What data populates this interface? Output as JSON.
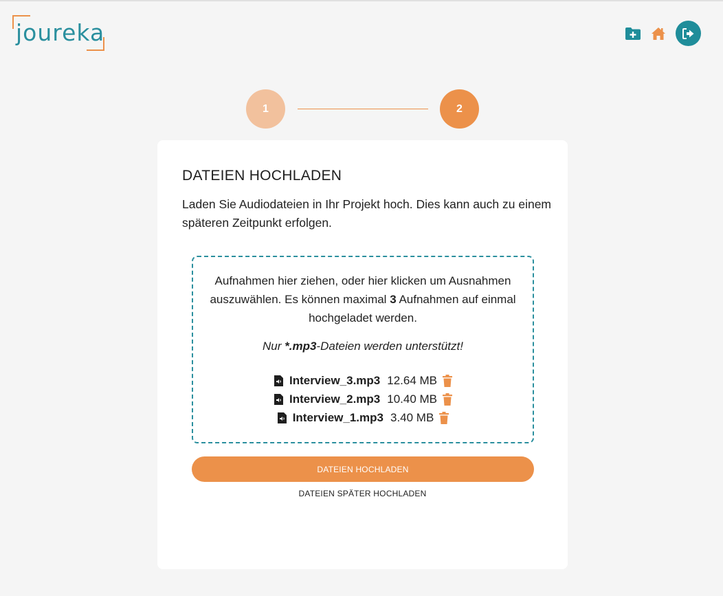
{
  "brand": {
    "logo_text": "joureka",
    "accent": "#ec914a",
    "primary": "#2a8f9e"
  },
  "header": {
    "icons": [
      "folder-plus-icon",
      "home-icon",
      "logout-icon"
    ]
  },
  "stepper": {
    "steps": [
      "1",
      "2"
    ],
    "active": 2
  },
  "card": {
    "title": "DATEIEN HOCHLADEN",
    "description": "Laden Sie Audiodateien in Ihr Projekt hoch. Dies kann auch zu einem späteren Zeitpunkt erfolgen."
  },
  "dropzone": {
    "text_before": "Aufnahmen hier ziehen, oder hier klicken um Ausnahmen auszuwählen. Es können maximal ",
    "max_count": "3",
    "text_after": " Aufnahmen auf einmal hochgeladet werden.",
    "note_prefix": "Nur ",
    "note_ext": "*.mp3",
    "note_suffix": "-Dateien werden unterstützt!",
    "files": [
      {
        "name": "Interview_3.mp3",
        "size": "12.64 MB"
      },
      {
        "name": "Interview_2.mp3",
        "size": "10.40 MB"
      },
      {
        "name": "Interview_1.mp3",
        "size": "3.40 MB"
      }
    ]
  },
  "actions": {
    "upload_label": "DATEIEN HOCHLADEN",
    "later_label": "DATEIEN SPÄTER HOCHLADEN"
  }
}
